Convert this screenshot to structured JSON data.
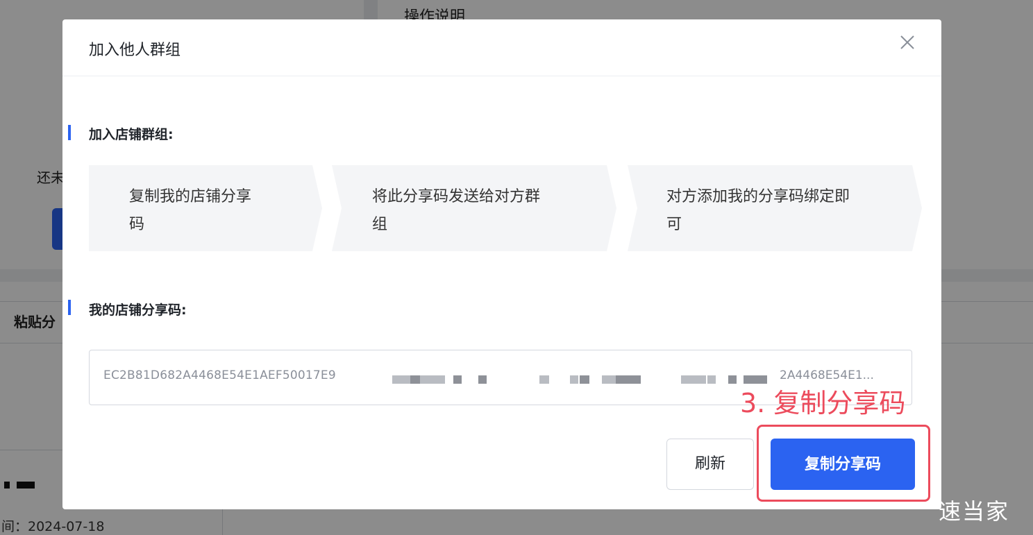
{
  "background": {
    "section_heading": "操作说明",
    "left_text": "还未",
    "paste_label": "粘贴分",
    "date_text": "间：2024-07-18"
  },
  "watermark": "速当家",
  "modal": {
    "title": "加入他人群组",
    "close_icon": "close-icon",
    "join_section": {
      "title": "加入店铺群组:",
      "steps": [
        {
          "line1": "复制我的店铺分享",
          "line2": "码"
        },
        {
          "line1": "将此分享码发送给对方群",
          "line2": "组"
        },
        {
          "line1": "对方添加我的分享码绑定即",
          "line2": "可"
        }
      ]
    },
    "share_section": {
      "title": "我的店铺分享码:",
      "code_visible_start": "EC2B81D682A4468E54E1AEF50017E9",
      "code_visible_end": "2A4468E54E1..."
    },
    "buttons": {
      "refresh": "刷新",
      "copy": "复制分享码"
    }
  },
  "annotation": {
    "label": "3. 复制分享码",
    "color": "#ec4b5c"
  },
  "colors": {
    "primary": "#2b63f1",
    "step_bg": "#f4f5f7",
    "overlay": "rgba(0,0,0,0.45)"
  }
}
